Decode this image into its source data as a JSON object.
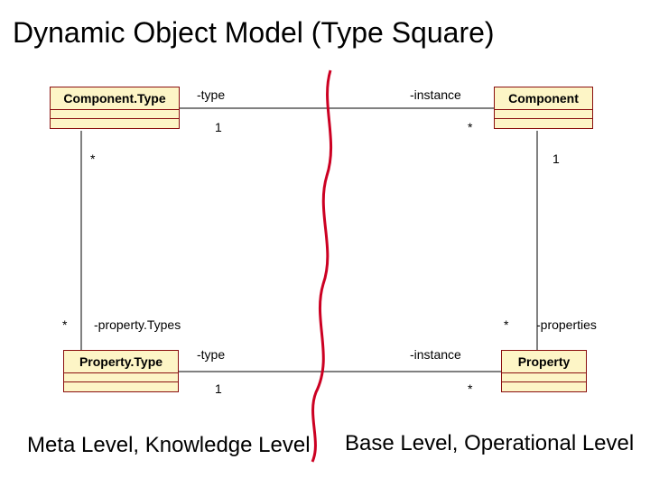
{
  "title": "Dynamic Object Model (Type Square)",
  "boxes": {
    "componentType": "Component.Type",
    "component": "Component",
    "propertyType": "Property.Type",
    "property": "Property"
  },
  "assoc": {
    "top": {
      "leftRole": "-type",
      "leftMult": "1",
      "rightRole": "-instance",
      "rightMult": "*"
    },
    "bottom": {
      "leftRole": "-type",
      "leftMult": "1",
      "rightRole": "-instance",
      "rightMult": "*"
    },
    "leftVert": {
      "topMult": "*",
      "bottomMult": "*",
      "bottomRole": "-property.Types"
    },
    "rightVert": {
      "topMult": "1",
      "bottomMult": "*",
      "bottomRole": "-properties"
    }
  },
  "captions": {
    "left": "Meta Level, Knowledge Level",
    "right": "Base Level, Operational Level"
  }
}
